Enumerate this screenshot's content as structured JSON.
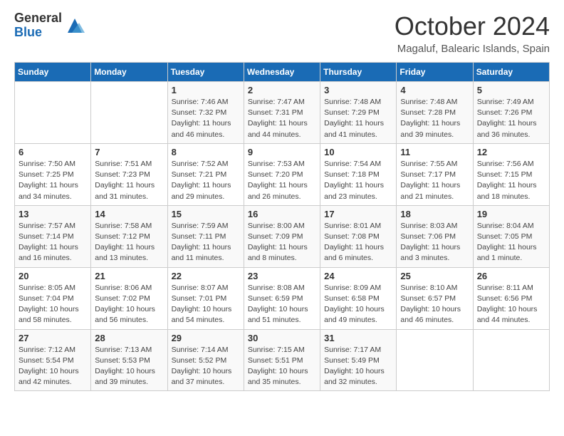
{
  "header": {
    "logo_general": "General",
    "logo_blue": "Blue",
    "month_title": "October 2024",
    "subtitle": "Magaluf, Balearic Islands, Spain"
  },
  "weekdays": [
    "Sunday",
    "Monday",
    "Tuesday",
    "Wednesday",
    "Thursday",
    "Friday",
    "Saturday"
  ],
  "weeks": [
    [
      {
        "day": null,
        "sunrise": null,
        "sunset": null,
        "daylight": null
      },
      {
        "day": null,
        "sunrise": null,
        "sunset": null,
        "daylight": null
      },
      {
        "day": "1",
        "sunrise": "Sunrise: 7:46 AM",
        "sunset": "Sunset: 7:32 PM",
        "daylight": "Daylight: 11 hours and 46 minutes."
      },
      {
        "day": "2",
        "sunrise": "Sunrise: 7:47 AM",
        "sunset": "Sunset: 7:31 PM",
        "daylight": "Daylight: 11 hours and 44 minutes."
      },
      {
        "day": "3",
        "sunrise": "Sunrise: 7:48 AM",
        "sunset": "Sunset: 7:29 PM",
        "daylight": "Daylight: 11 hours and 41 minutes."
      },
      {
        "day": "4",
        "sunrise": "Sunrise: 7:48 AM",
        "sunset": "Sunset: 7:28 PM",
        "daylight": "Daylight: 11 hours and 39 minutes."
      },
      {
        "day": "5",
        "sunrise": "Sunrise: 7:49 AM",
        "sunset": "Sunset: 7:26 PM",
        "daylight": "Daylight: 11 hours and 36 minutes."
      }
    ],
    [
      {
        "day": "6",
        "sunrise": "Sunrise: 7:50 AM",
        "sunset": "Sunset: 7:25 PM",
        "daylight": "Daylight: 11 hours and 34 minutes."
      },
      {
        "day": "7",
        "sunrise": "Sunrise: 7:51 AM",
        "sunset": "Sunset: 7:23 PM",
        "daylight": "Daylight: 11 hours and 31 minutes."
      },
      {
        "day": "8",
        "sunrise": "Sunrise: 7:52 AM",
        "sunset": "Sunset: 7:21 PM",
        "daylight": "Daylight: 11 hours and 29 minutes."
      },
      {
        "day": "9",
        "sunrise": "Sunrise: 7:53 AM",
        "sunset": "Sunset: 7:20 PM",
        "daylight": "Daylight: 11 hours and 26 minutes."
      },
      {
        "day": "10",
        "sunrise": "Sunrise: 7:54 AM",
        "sunset": "Sunset: 7:18 PM",
        "daylight": "Daylight: 11 hours and 23 minutes."
      },
      {
        "day": "11",
        "sunrise": "Sunrise: 7:55 AM",
        "sunset": "Sunset: 7:17 PM",
        "daylight": "Daylight: 11 hours and 21 minutes."
      },
      {
        "day": "12",
        "sunrise": "Sunrise: 7:56 AM",
        "sunset": "Sunset: 7:15 PM",
        "daylight": "Daylight: 11 hours and 18 minutes."
      }
    ],
    [
      {
        "day": "13",
        "sunrise": "Sunrise: 7:57 AM",
        "sunset": "Sunset: 7:14 PM",
        "daylight": "Daylight: 11 hours and 16 minutes."
      },
      {
        "day": "14",
        "sunrise": "Sunrise: 7:58 AM",
        "sunset": "Sunset: 7:12 PM",
        "daylight": "Daylight: 11 hours and 13 minutes."
      },
      {
        "day": "15",
        "sunrise": "Sunrise: 7:59 AM",
        "sunset": "Sunset: 7:11 PM",
        "daylight": "Daylight: 11 hours and 11 minutes."
      },
      {
        "day": "16",
        "sunrise": "Sunrise: 8:00 AM",
        "sunset": "Sunset: 7:09 PM",
        "daylight": "Daylight: 11 hours and 8 minutes."
      },
      {
        "day": "17",
        "sunrise": "Sunrise: 8:01 AM",
        "sunset": "Sunset: 7:08 PM",
        "daylight": "Daylight: 11 hours and 6 minutes."
      },
      {
        "day": "18",
        "sunrise": "Sunrise: 8:03 AM",
        "sunset": "Sunset: 7:06 PM",
        "daylight": "Daylight: 11 hours and 3 minutes."
      },
      {
        "day": "19",
        "sunrise": "Sunrise: 8:04 AM",
        "sunset": "Sunset: 7:05 PM",
        "daylight": "Daylight: 11 hours and 1 minute."
      }
    ],
    [
      {
        "day": "20",
        "sunrise": "Sunrise: 8:05 AM",
        "sunset": "Sunset: 7:04 PM",
        "daylight": "Daylight: 10 hours and 58 minutes."
      },
      {
        "day": "21",
        "sunrise": "Sunrise: 8:06 AM",
        "sunset": "Sunset: 7:02 PM",
        "daylight": "Daylight: 10 hours and 56 minutes."
      },
      {
        "day": "22",
        "sunrise": "Sunrise: 8:07 AM",
        "sunset": "Sunset: 7:01 PM",
        "daylight": "Daylight: 10 hours and 54 minutes."
      },
      {
        "day": "23",
        "sunrise": "Sunrise: 8:08 AM",
        "sunset": "Sunset: 6:59 PM",
        "daylight": "Daylight: 10 hours and 51 minutes."
      },
      {
        "day": "24",
        "sunrise": "Sunrise: 8:09 AM",
        "sunset": "Sunset: 6:58 PM",
        "daylight": "Daylight: 10 hours and 49 minutes."
      },
      {
        "day": "25",
        "sunrise": "Sunrise: 8:10 AM",
        "sunset": "Sunset: 6:57 PM",
        "daylight": "Daylight: 10 hours and 46 minutes."
      },
      {
        "day": "26",
        "sunrise": "Sunrise: 8:11 AM",
        "sunset": "Sunset: 6:56 PM",
        "daylight": "Daylight: 10 hours and 44 minutes."
      }
    ],
    [
      {
        "day": "27",
        "sunrise": "Sunrise: 7:12 AM",
        "sunset": "Sunset: 5:54 PM",
        "daylight": "Daylight: 10 hours and 42 minutes."
      },
      {
        "day": "28",
        "sunrise": "Sunrise: 7:13 AM",
        "sunset": "Sunset: 5:53 PM",
        "daylight": "Daylight: 10 hours and 39 minutes."
      },
      {
        "day": "29",
        "sunrise": "Sunrise: 7:14 AM",
        "sunset": "Sunset: 5:52 PM",
        "daylight": "Daylight: 10 hours and 37 minutes."
      },
      {
        "day": "30",
        "sunrise": "Sunrise: 7:15 AM",
        "sunset": "Sunset: 5:51 PM",
        "daylight": "Daylight: 10 hours and 35 minutes."
      },
      {
        "day": "31",
        "sunrise": "Sunrise: 7:17 AM",
        "sunset": "Sunset: 5:49 PM",
        "daylight": "Daylight: 10 hours and 32 minutes."
      },
      {
        "day": null,
        "sunrise": null,
        "sunset": null,
        "daylight": null
      },
      {
        "day": null,
        "sunrise": null,
        "sunset": null,
        "daylight": null
      }
    ]
  ]
}
